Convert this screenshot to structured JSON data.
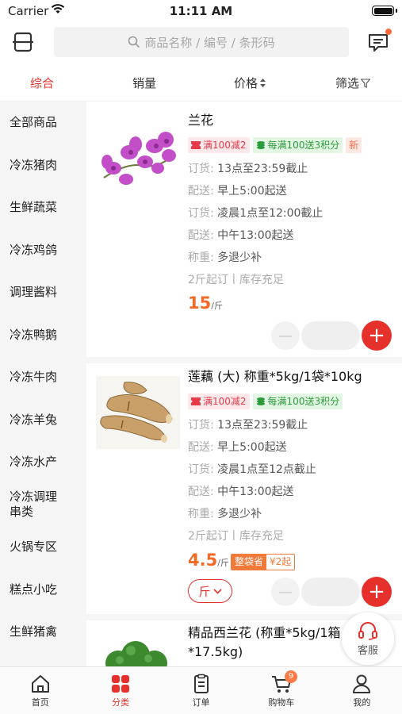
{
  "status_bar": {
    "carrier": "Carrier",
    "time": "11:11 AM"
  },
  "header": {
    "search_placeholder": "商品名称 / 编号 / 条形码"
  },
  "sort_bar": {
    "comprehensive": "综合",
    "sales": "销量",
    "price": "价格",
    "filter": "筛选"
  },
  "categories": [
    "全部商品",
    "冷冻猪肉",
    "生鲜蔬菜",
    "冷冻鸡鸽",
    "调理酱料",
    "冷冻鸭鹅",
    "冷冻牛肉",
    "冷冻羊兔",
    "冷冻水产",
    "冷冻调理串类",
    "火锅专区",
    "糕点小吃",
    "生鲜猪禽"
  ],
  "products": [
    {
      "name": "兰花",
      "tags": {
        "discount": "满100减2",
        "points": "每满100送3积分",
        "new": "新"
      },
      "order1_key": "订货:",
      "order1_val": "13点至23:59截止",
      "delivery1_key": "配送:",
      "delivery1_val": "早上5:00起送",
      "order2_key": "订货:",
      "order2_val": "凌晨1点至12:00截止",
      "delivery2_key": "配送:",
      "delivery2_val": "中午13:00起送",
      "weigh_key": "称重:",
      "weigh_val": "多退少补",
      "stock": "2斤起订丨库存充足",
      "price": "15",
      "unit": "/斤"
    },
    {
      "name": "莲藕  (大) 称重*5kg/1袋*10kg",
      "tags": {
        "discount": "满100减2",
        "points": "每满100送3积分"
      },
      "order1_key": "订货:",
      "order1_val": "13点至23:59截止",
      "delivery1_key": "配送:",
      "delivery1_val": "早上5:00起送",
      "order2_key": "订货:",
      "order2_val": "凌晨1点至12点截止",
      "delivery2_key": "配送:",
      "delivery2_val": "中午13:00起送",
      "weigh_key": "称重:",
      "weigh_val": "多退少补",
      "stock": "2斤起订丨库存充足",
      "price": "4.5",
      "unit": "/斤",
      "promo_label": "整袋省",
      "promo_value": "¥2起",
      "unit_select": "斤"
    },
    {
      "name": "精品西兰花 (称重*5kg/1箱*17.5kg)"
    }
  ],
  "customer_service": "客服",
  "tabbar": {
    "home": "首页",
    "category": "分类",
    "orders": "订单",
    "cart": "购物车",
    "cart_badge": "9",
    "mine": "我的"
  },
  "colors": {
    "accent": "#e6302b",
    "price": "#f26a25"
  }
}
